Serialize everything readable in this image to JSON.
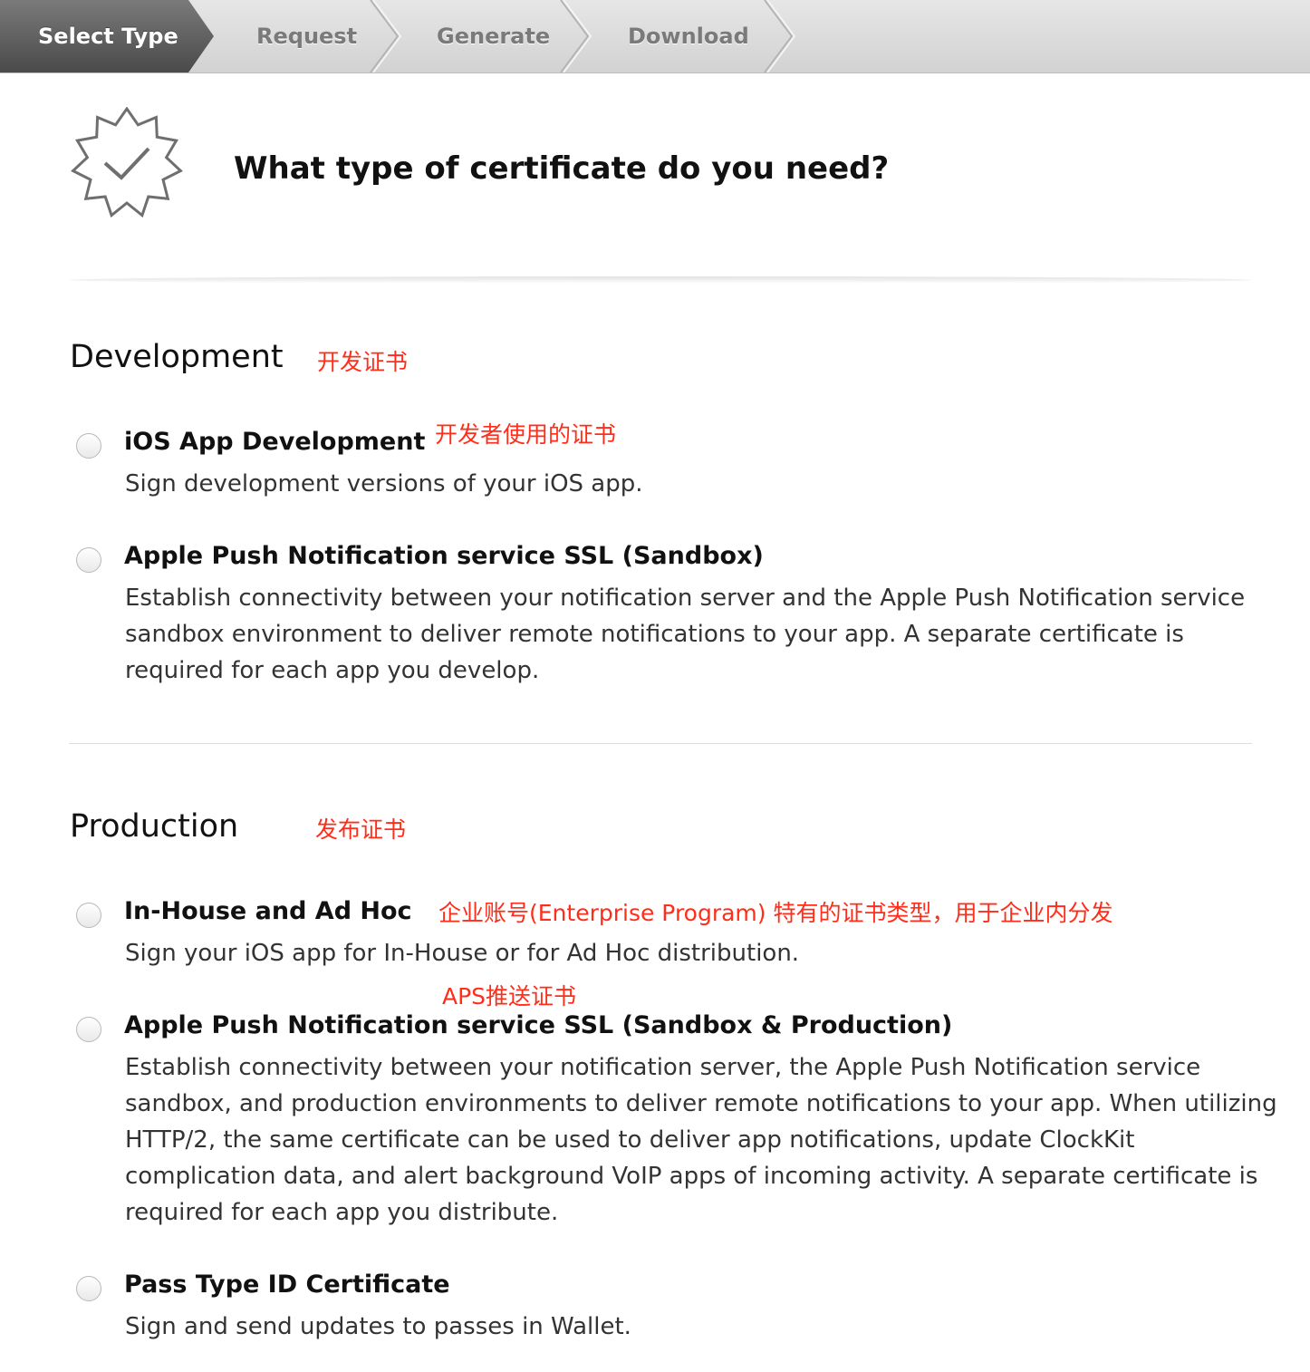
{
  "wizard": {
    "steps": [
      {
        "label": "Select Type",
        "active": true
      },
      {
        "label": "Request",
        "active": false
      },
      {
        "label": "Generate",
        "active": false
      },
      {
        "label": "Download",
        "active": false
      }
    ]
  },
  "header": {
    "icon": "certificate-badge-icon",
    "title": "What type of certificate do you need?"
  },
  "sections": {
    "development": {
      "title": "Development",
      "note": "开发证书",
      "options": [
        {
          "title": "iOS App Development",
          "note": "开发者使用的证书",
          "description": "Sign development versions of your iOS app."
        },
        {
          "title": "Apple Push Notification service SSL (Sandbox)",
          "description": "Establish connectivity between your notification server and the Apple Push Notification service sandbox environment to deliver remote notifications to your app. A separate certificate is required for each app you develop."
        }
      ]
    },
    "production": {
      "title": "Production",
      "note": "发布证书",
      "options": [
        {
          "title": "In-House and Ad Hoc",
          "note": "企业账号(Enterprise Program) 特有的证书类型，用于企业内分发",
          "description": "Sign your iOS app for In-House or for Ad Hoc distribution."
        },
        {
          "title": "Apple Push Notification service SSL (Sandbox & Production)",
          "note": "APS推送证书",
          "description": "Establish connectivity between your notification server, the Apple Push Notification service sandbox, and production environments to deliver remote notifications to your app. When utilizing HTTP/2, the same certificate can be used to deliver app notifications, update ClockKit complication data, and alert background VoIP apps of incoming activity. A separate certificate is required for each app you distribute."
        },
        {
          "title": "Pass Type ID Certificate",
          "description": "Sign and send updates to passes in Wallet."
        }
      ]
    }
  },
  "colors": {
    "annotation": "#ff2d1a",
    "active_step": "#555555",
    "step_bar": "#dcdcdc"
  }
}
